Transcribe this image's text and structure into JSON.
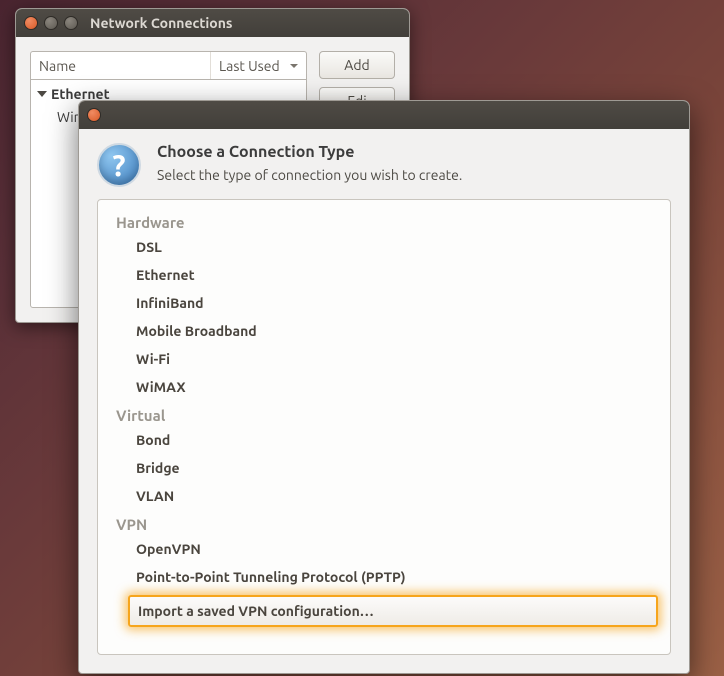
{
  "back_window": {
    "title": "Network Connections",
    "columns": {
      "name": "Name",
      "last_used": "Last Used"
    },
    "group": "Ethernet",
    "item_partial": "Wir",
    "buttons": {
      "add": "Add",
      "edit": "Edi"
    }
  },
  "dialog": {
    "title": "Choose a Connection Type",
    "subtitle": "Select the type of connection you wish to create.",
    "sections": [
      {
        "label": "Hardware",
        "options": [
          "DSL",
          "Ethernet",
          "InfiniBand",
          "Mobile Broadband",
          "Wi-Fi",
          "WiMAX"
        ]
      },
      {
        "label": "Virtual",
        "options": [
          "Bond",
          "Bridge",
          "VLAN"
        ]
      },
      {
        "label": "VPN",
        "options": [
          "OpenVPN",
          "Point-to-Point Tunneling Protocol (PPTP)"
        ]
      }
    ],
    "highlighted_option": "Import a saved VPN configuration…"
  }
}
